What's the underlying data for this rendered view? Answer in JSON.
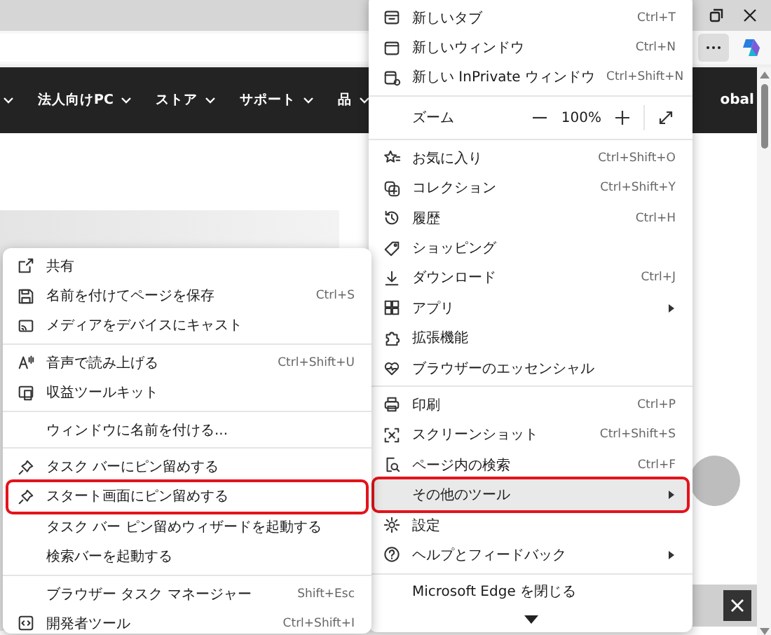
{
  "browser": {
    "nav_items": [
      {
        "label": "法人向けPC"
      },
      {
        "label": "ストア"
      },
      {
        "label": "サポート"
      },
      {
        "label": "品"
      }
    ],
    "nav_overflow": "obal"
  },
  "main_menu": {
    "items": [
      {
        "kind": "item",
        "label": "新しいタブ",
        "shortcut": "Ctrl+T",
        "submenu": false,
        "highlighted": false,
        "marked": false
      },
      {
        "kind": "item",
        "label": "新しいウィンドウ",
        "shortcut": "Ctrl+N",
        "submenu": false,
        "highlighted": false,
        "marked": false
      },
      {
        "kind": "item",
        "label": "新しい InPrivate ウィンドウ",
        "shortcut": "Ctrl+Shift+N",
        "submenu": false,
        "highlighted": false,
        "marked": false
      },
      {
        "kind": "divider"
      },
      {
        "kind": "zoom",
        "label": "ズーム",
        "value": "100%"
      },
      {
        "kind": "divider"
      },
      {
        "kind": "item",
        "label": "お気に入り",
        "shortcut": "Ctrl+Shift+O",
        "submenu": false,
        "highlighted": false,
        "marked": false
      },
      {
        "kind": "item",
        "label": "コレクション",
        "shortcut": "Ctrl+Shift+Y",
        "submenu": false,
        "highlighted": false,
        "marked": false
      },
      {
        "kind": "item",
        "label": "履歴",
        "shortcut": "Ctrl+H",
        "submenu": false,
        "highlighted": false,
        "marked": false
      },
      {
        "kind": "item",
        "label": "ショッピング",
        "submenu": false,
        "highlighted": false,
        "marked": false
      },
      {
        "kind": "item",
        "label": "ダウンロード",
        "shortcut": "Ctrl+J",
        "submenu": false,
        "highlighted": false,
        "marked": false
      },
      {
        "kind": "item",
        "label": "アプリ",
        "submenu": true,
        "highlighted": false,
        "marked": false
      },
      {
        "kind": "item",
        "label": "拡張機能",
        "submenu": false,
        "highlighted": false,
        "marked": false
      },
      {
        "kind": "item",
        "label": "ブラウザーのエッセンシャル",
        "submenu": false,
        "highlighted": false,
        "marked": false
      },
      {
        "kind": "divider"
      },
      {
        "kind": "item",
        "label": "印刷",
        "shortcut": "Ctrl+P",
        "submenu": false,
        "highlighted": false,
        "marked": false
      },
      {
        "kind": "item",
        "label": "スクリーンショット",
        "shortcut": "Ctrl+Shift+S",
        "submenu": false,
        "highlighted": false,
        "marked": false
      },
      {
        "kind": "item",
        "label": "ページ内の検索",
        "shortcut": "Ctrl+F",
        "submenu": false,
        "highlighted": false,
        "marked": false
      },
      {
        "kind": "item",
        "label": "その他のツール",
        "submenu": true,
        "highlighted": true,
        "marked": true
      },
      {
        "kind": "item",
        "label": "設定",
        "submenu": false,
        "highlighted": false,
        "marked": false
      },
      {
        "kind": "item",
        "label": "ヘルプとフィードバック",
        "submenu": true,
        "highlighted": false,
        "marked": false
      },
      {
        "kind": "divider"
      },
      {
        "kind": "item",
        "label": "Microsoft Edge を閉じる",
        "submenu": false,
        "highlighted": false,
        "marked": false
      },
      {
        "kind": "more"
      }
    ]
  },
  "sub_menu": {
    "items": [
      {
        "kind": "item",
        "label": "共有",
        "submenu": false,
        "highlighted": false,
        "marked": false
      },
      {
        "kind": "item",
        "label": "名前を付けてページを保存",
        "shortcut": "Ctrl+S",
        "submenu": false,
        "highlighted": false,
        "marked": false
      },
      {
        "kind": "item",
        "label": "メディアをデバイスにキャスト",
        "submenu": false,
        "highlighted": false,
        "marked": false
      },
      {
        "kind": "divider"
      },
      {
        "kind": "item",
        "label": "音声で読み上げる",
        "shortcut": "Ctrl+Shift+U",
        "submenu": false,
        "highlighted": false,
        "marked": false
      },
      {
        "kind": "item",
        "label": "収益ツールキット",
        "submenu": false,
        "highlighted": false,
        "marked": false
      },
      {
        "kind": "divider"
      },
      {
        "kind": "item",
        "label": "ウィンドウに名前を付ける...",
        "submenu": false,
        "highlighted": false,
        "marked": false
      },
      {
        "kind": "divider"
      },
      {
        "kind": "item",
        "label": "タスク バーにピン留めする",
        "submenu": false,
        "highlighted": false,
        "marked": false
      },
      {
        "kind": "item",
        "label": "スタート画面にピン留めする",
        "submenu": false,
        "highlighted": false,
        "marked": true
      },
      {
        "kind": "item",
        "label": "タスク バー ピン留めウィザードを起動する",
        "submenu": false,
        "highlighted": false,
        "marked": false
      },
      {
        "kind": "item",
        "label": "検索バーを起動する",
        "submenu": false,
        "highlighted": false,
        "marked": false
      },
      {
        "kind": "divider"
      },
      {
        "kind": "item",
        "label": "ブラウザー タスク マネージャー",
        "shortcut": "Shift+Esc",
        "submenu": false,
        "highlighted": false,
        "marked": false
      },
      {
        "kind": "item",
        "label": "開発者ツール",
        "shortcut": "Ctrl+Shift+I",
        "submenu": false,
        "highlighted": false,
        "marked": false
      }
    ]
  }
}
